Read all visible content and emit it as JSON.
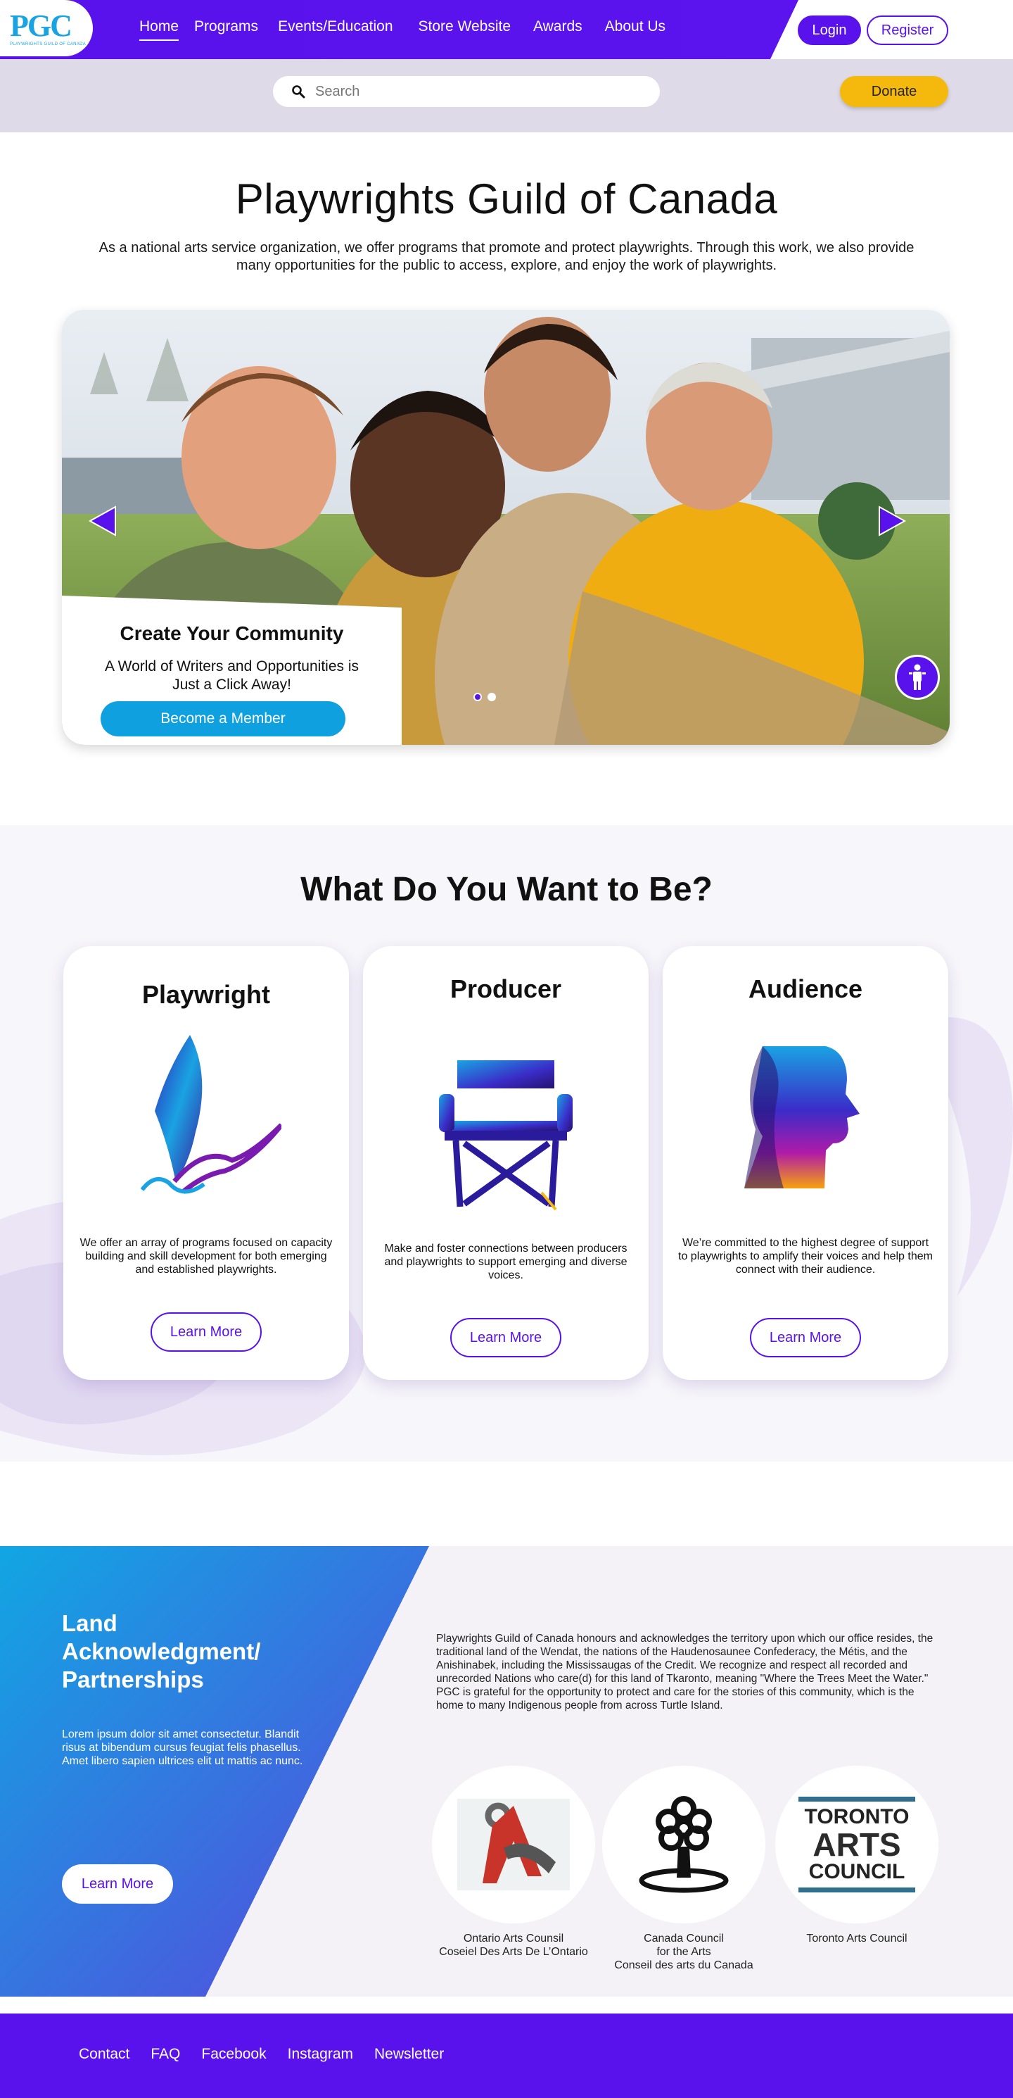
{
  "logo": {
    "mark": "PGC",
    "sub": "PLAYWRIGHTS GUILD OF CANADA"
  },
  "nav": {
    "items": [
      {
        "label": "Home"
      },
      {
        "label": "Programs"
      },
      {
        "label": "Events/Education"
      },
      {
        "label": "Store Website"
      },
      {
        "label": "Awards"
      },
      {
        "label": "About Us"
      }
    ],
    "login": "Login",
    "register": "Register"
  },
  "search": {
    "placeholder": "Search",
    "icon": "search-icon"
  },
  "donate": "Donate",
  "hero": {
    "title": "Playwrights Guild of Canada",
    "intro": "As a national arts service organization, we offer programs that promote and protect playwrights. Through this work, we also provide many opportunities for the public to access, explore, and enjoy the work of playwrights.",
    "slide": {
      "title": "Create Your Community",
      "subtitle": "A World of Writers and Opportunities is Just a Click Away!",
      "button": "Become a Member",
      "current": 1,
      "total": 2
    }
  },
  "roles": {
    "title": "What Do You Want to Be?",
    "cards": [
      {
        "title": "Playwright",
        "text": "We offer an array of programs focused on capacity building and skill development for both emerging and established playwrights.",
        "button": "Learn More",
        "icon": "quill-icon"
      },
      {
        "title": "Producer",
        "text": "Make and foster connections between producers and playwrights to support emerging and diverse voices.",
        "button": "Learn More",
        "icon": "directors-chair-icon"
      },
      {
        "title": "Audience",
        "text": "We’re committed to the highest degree of support to playwrights to amplify their voices  and help them connect with their audience.",
        "button": "Learn More",
        "icon": "head-profile-icon"
      }
    ]
  },
  "land": {
    "title": "Land Acknowledgment/ Partnerships",
    "lorem": "Lorem ipsum dolor sit amet consectetur. Blandit risus at bibendum cursus feugiat felis phasellus. Amet libero sapien ultrices elit ut mattis ac nunc.",
    "button": "Learn More",
    "acknowledgment": "Playwrights Guild of Canada honours and acknowledges the territory upon which our office resides, the traditional land of the Wendat, the nations of the Haudenosaunee Confederacy, the Métis, and the Anishinabek, including the Mississaugas of the Credit. We recognize and respect all recorded and unrecorded Nations who care(d) for this land of Tkaronto, meaning \"Where the Trees Meet the Water.\" PGC is grateful for the opportunity to protect and care for the stories of this community, which is the home to many Indigenous people from across Turtle Island.",
    "partners": [
      {
        "caption": "Ontario Arts Counsil\nCoseiel Des Arts De L’Ontario"
      },
      {
        "caption": "Canada Council\nfor the Arts\nConseil des arts du Canada"
      },
      {
        "caption": "Toronto Arts Council",
        "logo_lines": [
          "TORONTO",
          "ARTS",
          "COUNCIL"
        ]
      }
    ]
  },
  "footer": {
    "links": [
      "Contact",
      "FAQ",
      "Facebook",
      "Instagram",
      "Newsletter"
    ]
  },
  "colors": {
    "brand": "#5a12ec",
    "accent": "#0fa1df",
    "donate": "#f5b90d"
  }
}
